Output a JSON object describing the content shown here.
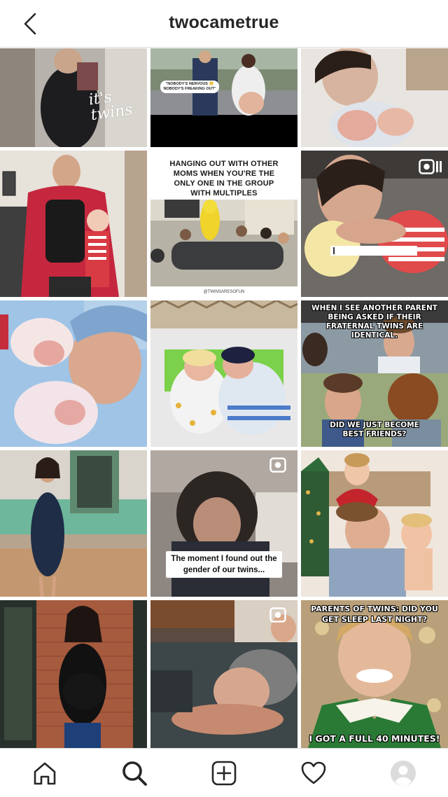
{
  "header": {
    "title": "twocametrue",
    "back_icon": "chevron-left-icon"
  },
  "grid": {
    "posts": [
      {
        "id": "p1",
        "overlay_text": "it's twins",
        "type": "photo"
      },
      {
        "id": "p2",
        "overlay_text": "\"NOBODY'S NERVOUS 😬 NOBODY'S FREAKING OUT\"",
        "type": "video"
      },
      {
        "id": "p3",
        "overlay_text": "",
        "type": "photo"
      },
      {
        "id": "p4",
        "overlay_text": "",
        "type": "photo"
      },
      {
        "id": "p5",
        "overlay_text": "HANGING OUT WITH OTHER MOMS WHEN YOU'RE THE ONLY ONE IN THE GROUP WITH MULTIPLES",
        "sub_text": "@TWINSARESOFUN",
        "type": "photo"
      },
      {
        "id": "p6",
        "overlay_text": "",
        "type": "reel"
      },
      {
        "id": "p7",
        "overlay_text": "",
        "type": "photo"
      },
      {
        "id": "p8",
        "overlay_text": "",
        "type": "photo"
      },
      {
        "id": "p9",
        "overlay_text": "WHEN I SEE ANOTHER PARENT BEING ASKED IF THEIR FRATERNAL TWINS ARE IDENTICAL.",
        "bottom_text": "DID WE JUST BECOME BEST FRIENDS?",
        "type": "photo"
      },
      {
        "id": "p10",
        "overlay_text": "",
        "type": "photo"
      },
      {
        "id": "p11",
        "overlay_text": "The moment I found out the gender of our twins...",
        "type": "video"
      },
      {
        "id": "p12",
        "overlay_text": "",
        "type": "photo"
      },
      {
        "id": "p13",
        "overlay_text": "",
        "type": "photo"
      },
      {
        "id": "p14",
        "overlay_text": "",
        "type": "video"
      },
      {
        "id": "p15",
        "overlay_text": "PARENTS OF TWINS: DID YOU GET SLEEP LAST NIGHT?",
        "bottom_text": "I GOT A FULL 40 MINUTES!",
        "type": "photo"
      }
    ]
  },
  "nav": {
    "items": [
      {
        "name": "home",
        "icon": "home-icon"
      },
      {
        "name": "search",
        "icon": "search-icon"
      },
      {
        "name": "new-post",
        "icon": "plus-square-icon"
      },
      {
        "name": "activity",
        "icon": "heart-icon"
      },
      {
        "name": "profile",
        "icon": "avatar-icon"
      }
    ]
  },
  "colors": {
    "border": "#dbdbdb",
    "text": "#262626",
    "background": "#ffffff"
  }
}
